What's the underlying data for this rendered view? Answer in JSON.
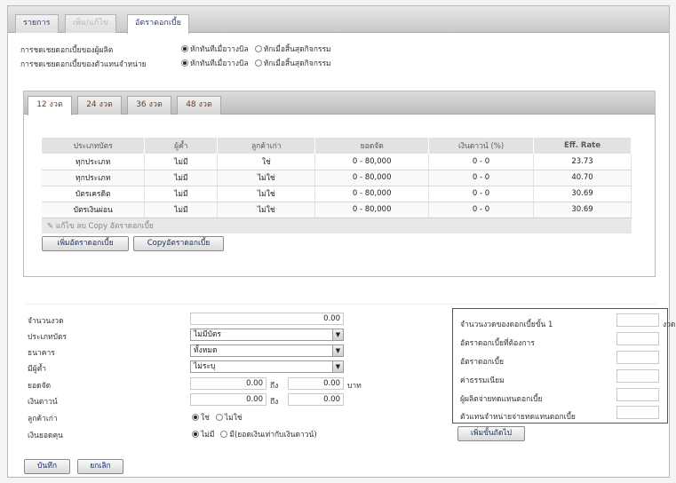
{
  "top_tabs": [
    {
      "label": "รายการ"
    },
    {
      "label": "เพิ่ม/แก้ไข"
    },
    {
      "label": "อัตราดอกเบี้ย"
    }
  ],
  "payment_options": {
    "customer_label": "การชดเชยดอกเบี้ยของผู้ผลิต",
    "dealer_label": "การชดเชยดอกเบี้ยของตัวแทนจำหน่าย",
    "opt_deduct_now": "หักทันทีเมื่อวางบิล",
    "opt_deduct_end": "หักเมื่อสิ้นสุดกิจกรรม"
  },
  "installment_tabs": [
    "12 งวด",
    "24 งวด",
    "36 งวด",
    "48 งวด"
  ],
  "rates_table": {
    "headers": [
      "ประเภทบัตร",
      "ผู้ค้ำ",
      "ลูกค้าเก่า",
      "ยอดจัด",
      "เงินดาวน์ (%)",
      "Eff. Rate"
    ],
    "rows": [
      [
        "ทุกประเภท",
        "ไม่มี",
        "ใช่",
        "0 - 80,000",
        "0 - 0",
        "23.73"
      ],
      [
        "ทุกประเภท",
        "ไม่มี",
        "ไม่ใช่",
        "0 - 80,000",
        "0 - 0",
        "40.70"
      ],
      [
        "บัตรเครดิต",
        "ไม่มี",
        "ไม่ใช่",
        "0 - 80,000",
        "0 - 0",
        "30.69"
      ],
      [
        "บัตรเงินผ่อน",
        "ไม่มี",
        "ไม่ใช่",
        "0 - 80,000",
        "0 - 0",
        "30.69"
      ]
    ],
    "footer_actions": "แก้ไข ลบ Copy อัตราดอกเบี้ย"
  },
  "buttons": {
    "add_rate": "เพิ่มอัตราดอกเบี้ย",
    "copy_rate": "Copyอัตราดอกเบี้ย",
    "add_next_step": "เพิ่มขั้นถัดไป",
    "save": "บันทึก",
    "cancel": "ยกเลิก"
  },
  "form": {
    "installments_label": "จำนวนงวด",
    "installments_value": "0.00",
    "card_type_label": "ประเภทบัตร",
    "card_type_value": "ไม่มีบัตร",
    "bank_label": "ธนาคาร",
    "bank_value": "ทั้งหมด",
    "guarantor_label": "มีผู้ค้ำ",
    "guarantor_value": "ไม่ระบุ",
    "amount_label": "ยอดจัด",
    "amount_from": "0.00",
    "amount_to_word": "ถึง",
    "amount_to": "0.00",
    "amount_unit": "บาท",
    "down_label": "เงินดาวน์",
    "down_from": "0.00",
    "down_to_word": "ถึง",
    "down_to": "0.00",
    "old_customer_label": "ลูกค้าเก่า",
    "old_customer_yes": "ใช่",
    "old_customer_no": "ไม่ใช่",
    "balloon_label": "เงินยอดคุน",
    "balloon_no": "ไม่มี",
    "balloon_yes": "มี(ยอดเงินเท่ากับเงินดาวน์)"
  },
  "side_panel": {
    "step_label": "จำนวนงวดของดอกเบี้ยขั้น 1",
    "step_unit": "งวด",
    "required_rate": "อัตราดอกเบี้ยที่ต้องการ",
    "interest_rate": "อัตราดอกเบี้ย",
    "fee": "ค่าธรรมเนียม",
    "maker_pays": "ผู้ผลิตจ่ายทดแทนดอกเบี้ย",
    "dealer_pays": "ตัวแทนจำหน่ายจ่ายทดแทนดอกเบี้ย"
  }
}
